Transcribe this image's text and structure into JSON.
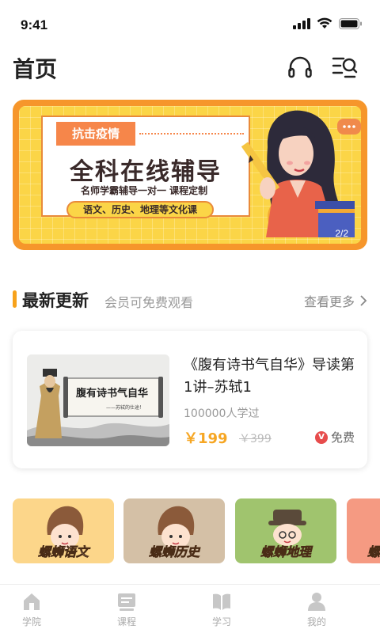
{
  "status": {
    "time": "9:41"
  },
  "header": {
    "title": "首页"
  },
  "banner": {
    "tag": "抗击疫情",
    "title": "全科在线辅导",
    "subtitle": "名师学霸辅导一对一 课程定制",
    "subjects": "语文、历史、地理等文化课",
    "counter": "2/2"
  },
  "section": {
    "title": "最新更新",
    "subtitle": "会员可免费观看",
    "more": "查看更多"
  },
  "course": {
    "thumb_title": "腹有诗书气自华",
    "thumb_caption": "——苏轼的仕途！",
    "title": "《腹有诗书气自华》导读第1讲–苏轼1",
    "learners": "100000人学过",
    "price": "￥199",
    "original_price": "￥399",
    "free_label": "免费"
  },
  "subjects": [
    {
      "label": "螺蛳语文",
      "bg": "#fcd68a"
    },
    {
      "label": "螺蛳历史",
      "bg": "#d4c0a6"
    },
    {
      "label": "螺蛳地理",
      "bg": "#a0c46e"
    },
    {
      "label": "螺",
      "bg": "#f59a82"
    }
  ],
  "tabs": [
    {
      "label": "学院",
      "icon": "home-icon"
    },
    {
      "label": "课程",
      "icon": "course-icon"
    },
    {
      "label": "学习",
      "icon": "book-icon"
    },
    {
      "label": "我的",
      "icon": "profile-icon"
    }
  ],
  "colors": {
    "accent": "#f7a21b",
    "price": "#f6a623",
    "banner": "#f6962b"
  }
}
